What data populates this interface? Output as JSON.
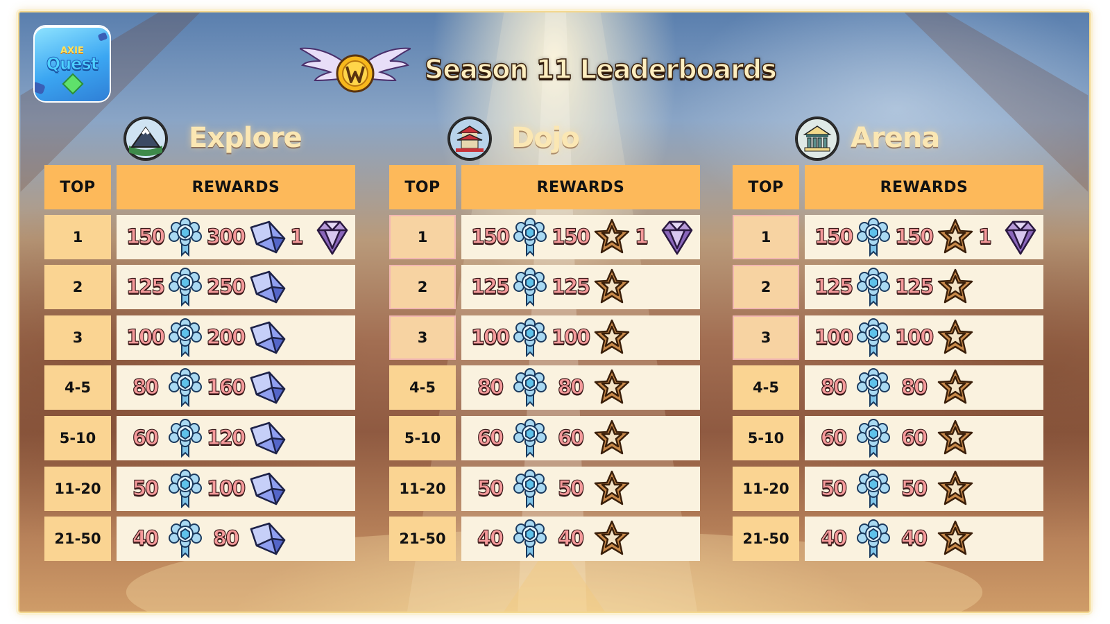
{
  "header": {
    "title": "Season 11 Leaderboards",
    "logo": {
      "top": "AXIE",
      "word": "Quest"
    }
  },
  "columns": {
    "top": "TOP",
    "rewards": "REWARDS"
  },
  "boards": [
    {
      "name": "Explore",
      "icon": "mountain-icon",
      "rows": [
        {
          "rank": "1",
          "medals": "150",
          "second": "300",
          "extra": "1"
        },
        {
          "rank": "2",
          "medals": "125",
          "second": "250"
        },
        {
          "rank": "3",
          "medals": "100",
          "second": "200"
        },
        {
          "rank": "4-5",
          "medals": "80",
          "second": "160"
        },
        {
          "rank": "5-10",
          "medals": "60",
          "second": "120"
        },
        {
          "rank": "11-20",
          "medals": "50",
          "second": "100"
        },
        {
          "rank": "21-50",
          "medals": "40",
          "second": "80"
        }
      ],
      "second_icon": "crystal-shard-icon"
    },
    {
      "name": "Dojo",
      "icon": "pagoda-icon",
      "rows": [
        {
          "rank": "1",
          "medals": "150",
          "second": "150",
          "extra": "1"
        },
        {
          "rank": "2",
          "medals": "125",
          "second": "125"
        },
        {
          "rank": "3",
          "medals": "100",
          "second": "100"
        },
        {
          "rank": "4-5",
          "medals": "80",
          "second": "80"
        },
        {
          "rank": "5-10",
          "medals": "60",
          "second": "60"
        },
        {
          "rank": "11-20",
          "medals": "50",
          "second": "50"
        },
        {
          "rank": "21-50",
          "medals": "40",
          "second": "40"
        }
      ],
      "second_icon": "bronze-star-icon"
    },
    {
      "name": "Arena",
      "icon": "temple-icon",
      "rows": [
        {
          "rank": "1",
          "medals": "150",
          "second": "150",
          "extra": "1"
        },
        {
          "rank": "2",
          "medals": "125",
          "second": "125"
        },
        {
          "rank": "3",
          "medals": "100",
          "second": "100"
        },
        {
          "rank": "4-5",
          "medals": "80",
          "second": "80"
        },
        {
          "rank": "5-10",
          "medals": "60",
          "second": "60"
        },
        {
          "rank": "11-20",
          "medals": "50",
          "second": "50"
        },
        {
          "rank": "21-50",
          "medals": "40",
          "second": "40"
        }
      ],
      "second_icon": "bronze-star-icon"
    }
  ],
  "colors": {
    "header_cell": "#fdb95a",
    "rank_cell": "#fad492",
    "reward_cell": "#faf2df",
    "number_fill": "#f59a9b",
    "title_text": "#fdeec0"
  }
}
